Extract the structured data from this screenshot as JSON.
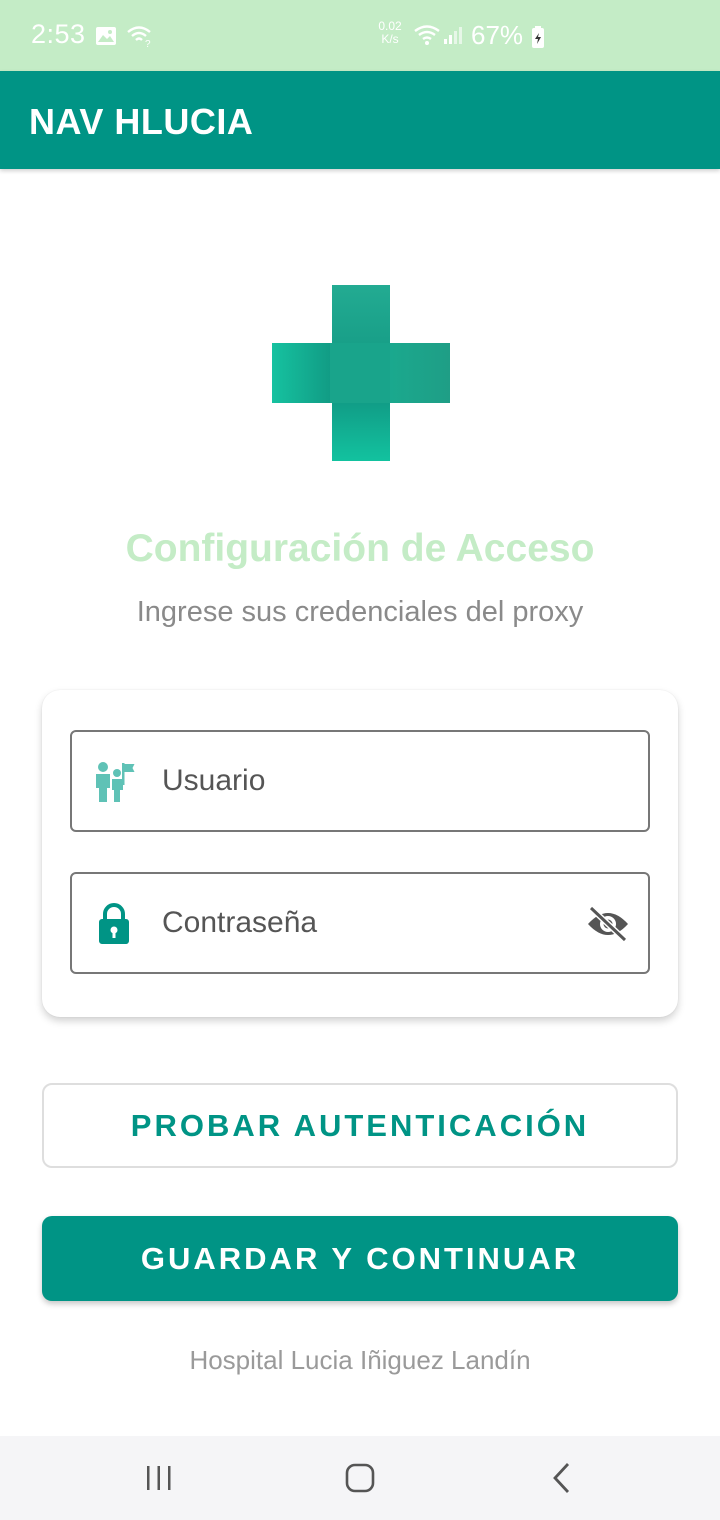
{
  "status_bar": {
    "time": "2:53",
    "net_speed_value": "0.02",
    "net_speed_unit": "K/s",
    "battery_percent": "67%",
    "icons": [
      "gallery-icon",
      "wifi-question-icon",
      "wifi-icon",
      "signal-icon",
      "battery-icon"
    ]
  },
  "app_bar": {
    "title": "NAV HLUCIA"
  },
  "logo": {
    "icon": "medical-cross-icon"
  },
  "header": {
    "title": "Configuración de Acceso",
    "subtitle": "Ingrese sus credenciales del proxy"
  },
  "form": {
    "username": {
      "placeholder": "Usuario",
      "icon": "user-flag-icon"
    },
    "password": {
      "placeholder": "Contraseña",
      "icon": "lock-icon",
      "toggle_icon": "visibility-off-icon"
    }
  },
  "buttons": {
    "test_auth": "PROBAR AUTENTICACIÓN",
    "save_continue": "GUARDAR Y CONTINUAR"
  },
  "footer": {
    "text": "Hospital Lucia Iñiguez Landín"
  },
  "nav_bar": {
    "icons": [
      "recents-icon",
      "home-icon",
      "back-icon"
    ]
  },
  "colors": {
    "primary": "#009485",
    "status_bar": "#c4ecc6",
    "heading": "#c4ecc6",
    "icon_teal": "#5fc2b6"
  }
}
